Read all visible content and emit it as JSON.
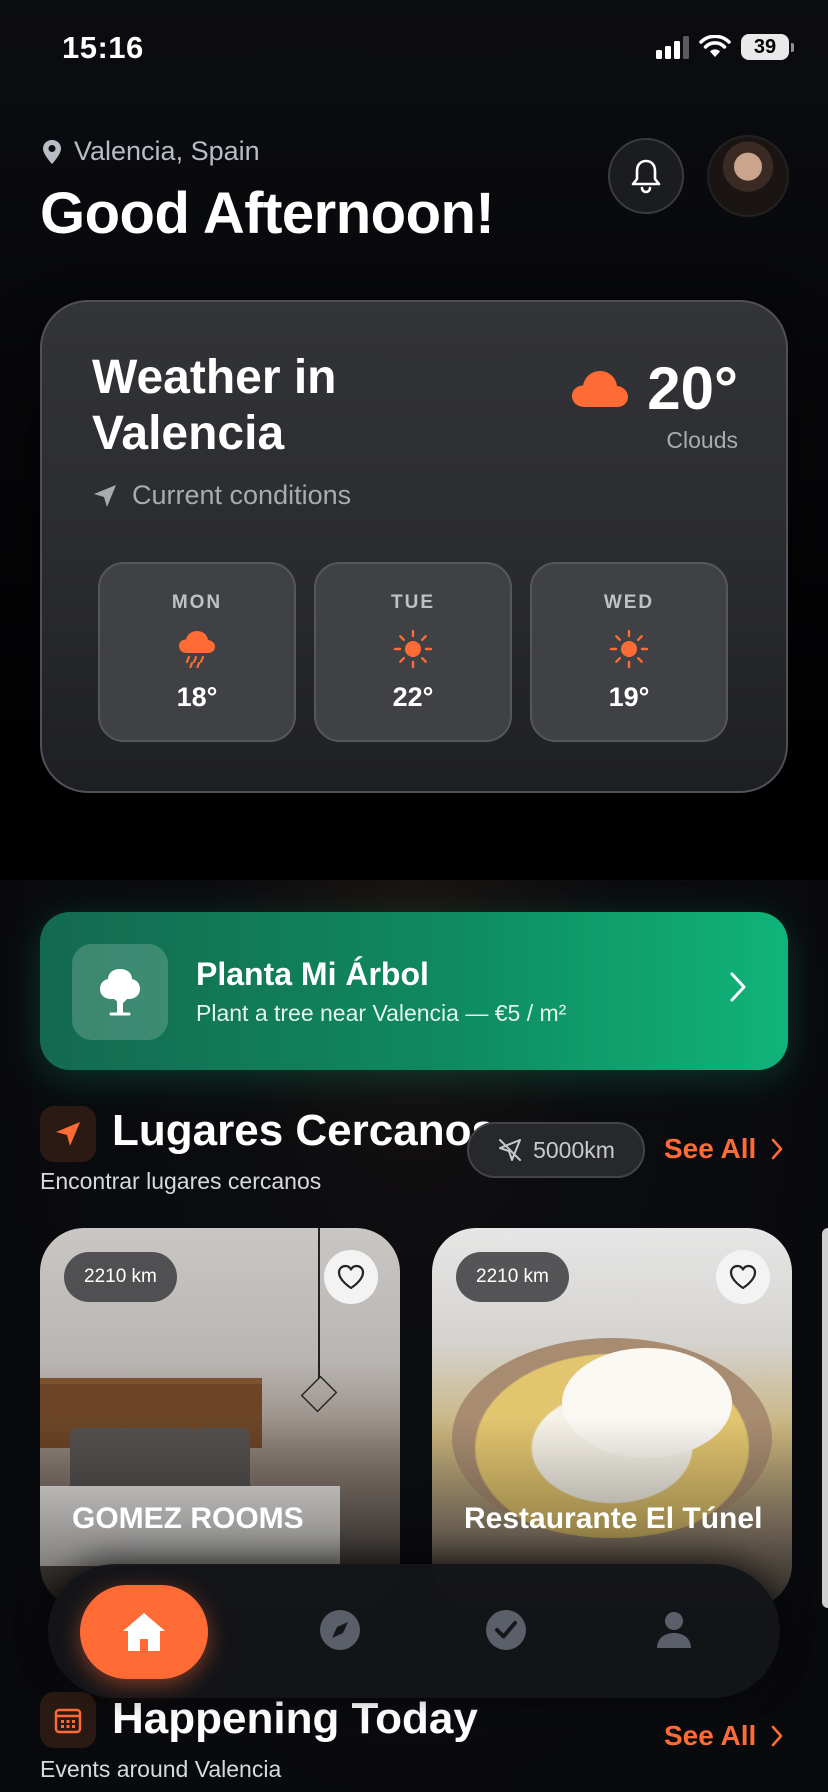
{
  "status_bar": {
    "time": "15:16",
    "battery": "39"
  },
  "header": {
    "location": "Valencia, Spain",
    "greeting": "Good Afternoon!",
    "icons": {
      "location": "map-pin-icon",
      "notifications": "bell-icon",
      "avatar": "user-avatar"
    }
  },
  "weather": {
    "title": "Weather in Valencia",
    "subtitle": "Current conditions",
    "current_temp": "20°",
    "current_desc": "Clouds",
    "current_icon": "cloud-icon",
    "forecast": [
      {
        "day": "MON",
        "temp": "18°",
        "icon": "rain-cloud-icon"
      },
      {
        "day": "TUE",
        "temp": "22°",
        "icon": "sun-icon"
      },
      {
        "day": "WED",
        "temp": "19°",
        "icon": "sun-icon"
      }
    ]
  },
  "tree_banner": {
    "title": "Planta Mi Árbol",
    "subtitle": "Plant a tree near Valencia — €5 / m²",
    "icon": "tree-icon"
  },
  "nearby": {
    "title": "Lugares Cercanos",
    "subtitle": "Encontrar lugares cercanos",
    "distance_filter": "5000km",
    "see_all": "See All",
    "places": [
      {
        "name": "GOMEZ ROOMS",
        "distance": "2210 km"
      },
      {
        "name": "Restaurante El Túnel",
        "distance": "2210 km"
      }
    ]
  },
  "happening": {
    "title": "Happening Today",
    "subtitle": "Events around Valencia",
    "see_all": "See All",
    "icon": "calendar-icon"
  },
  "bottom_nav": {
    "items": [
      "home-icon",
      "compass-icon",
      "check-circle-icon",
      "profile-icon"
    ],
    "active": "home-icon"
  },
  "colors": {
    "accent": "#ff6b35",
    "green_banner": "#10b47a",
    "card_bg": "#2d2e32"
  }
}
